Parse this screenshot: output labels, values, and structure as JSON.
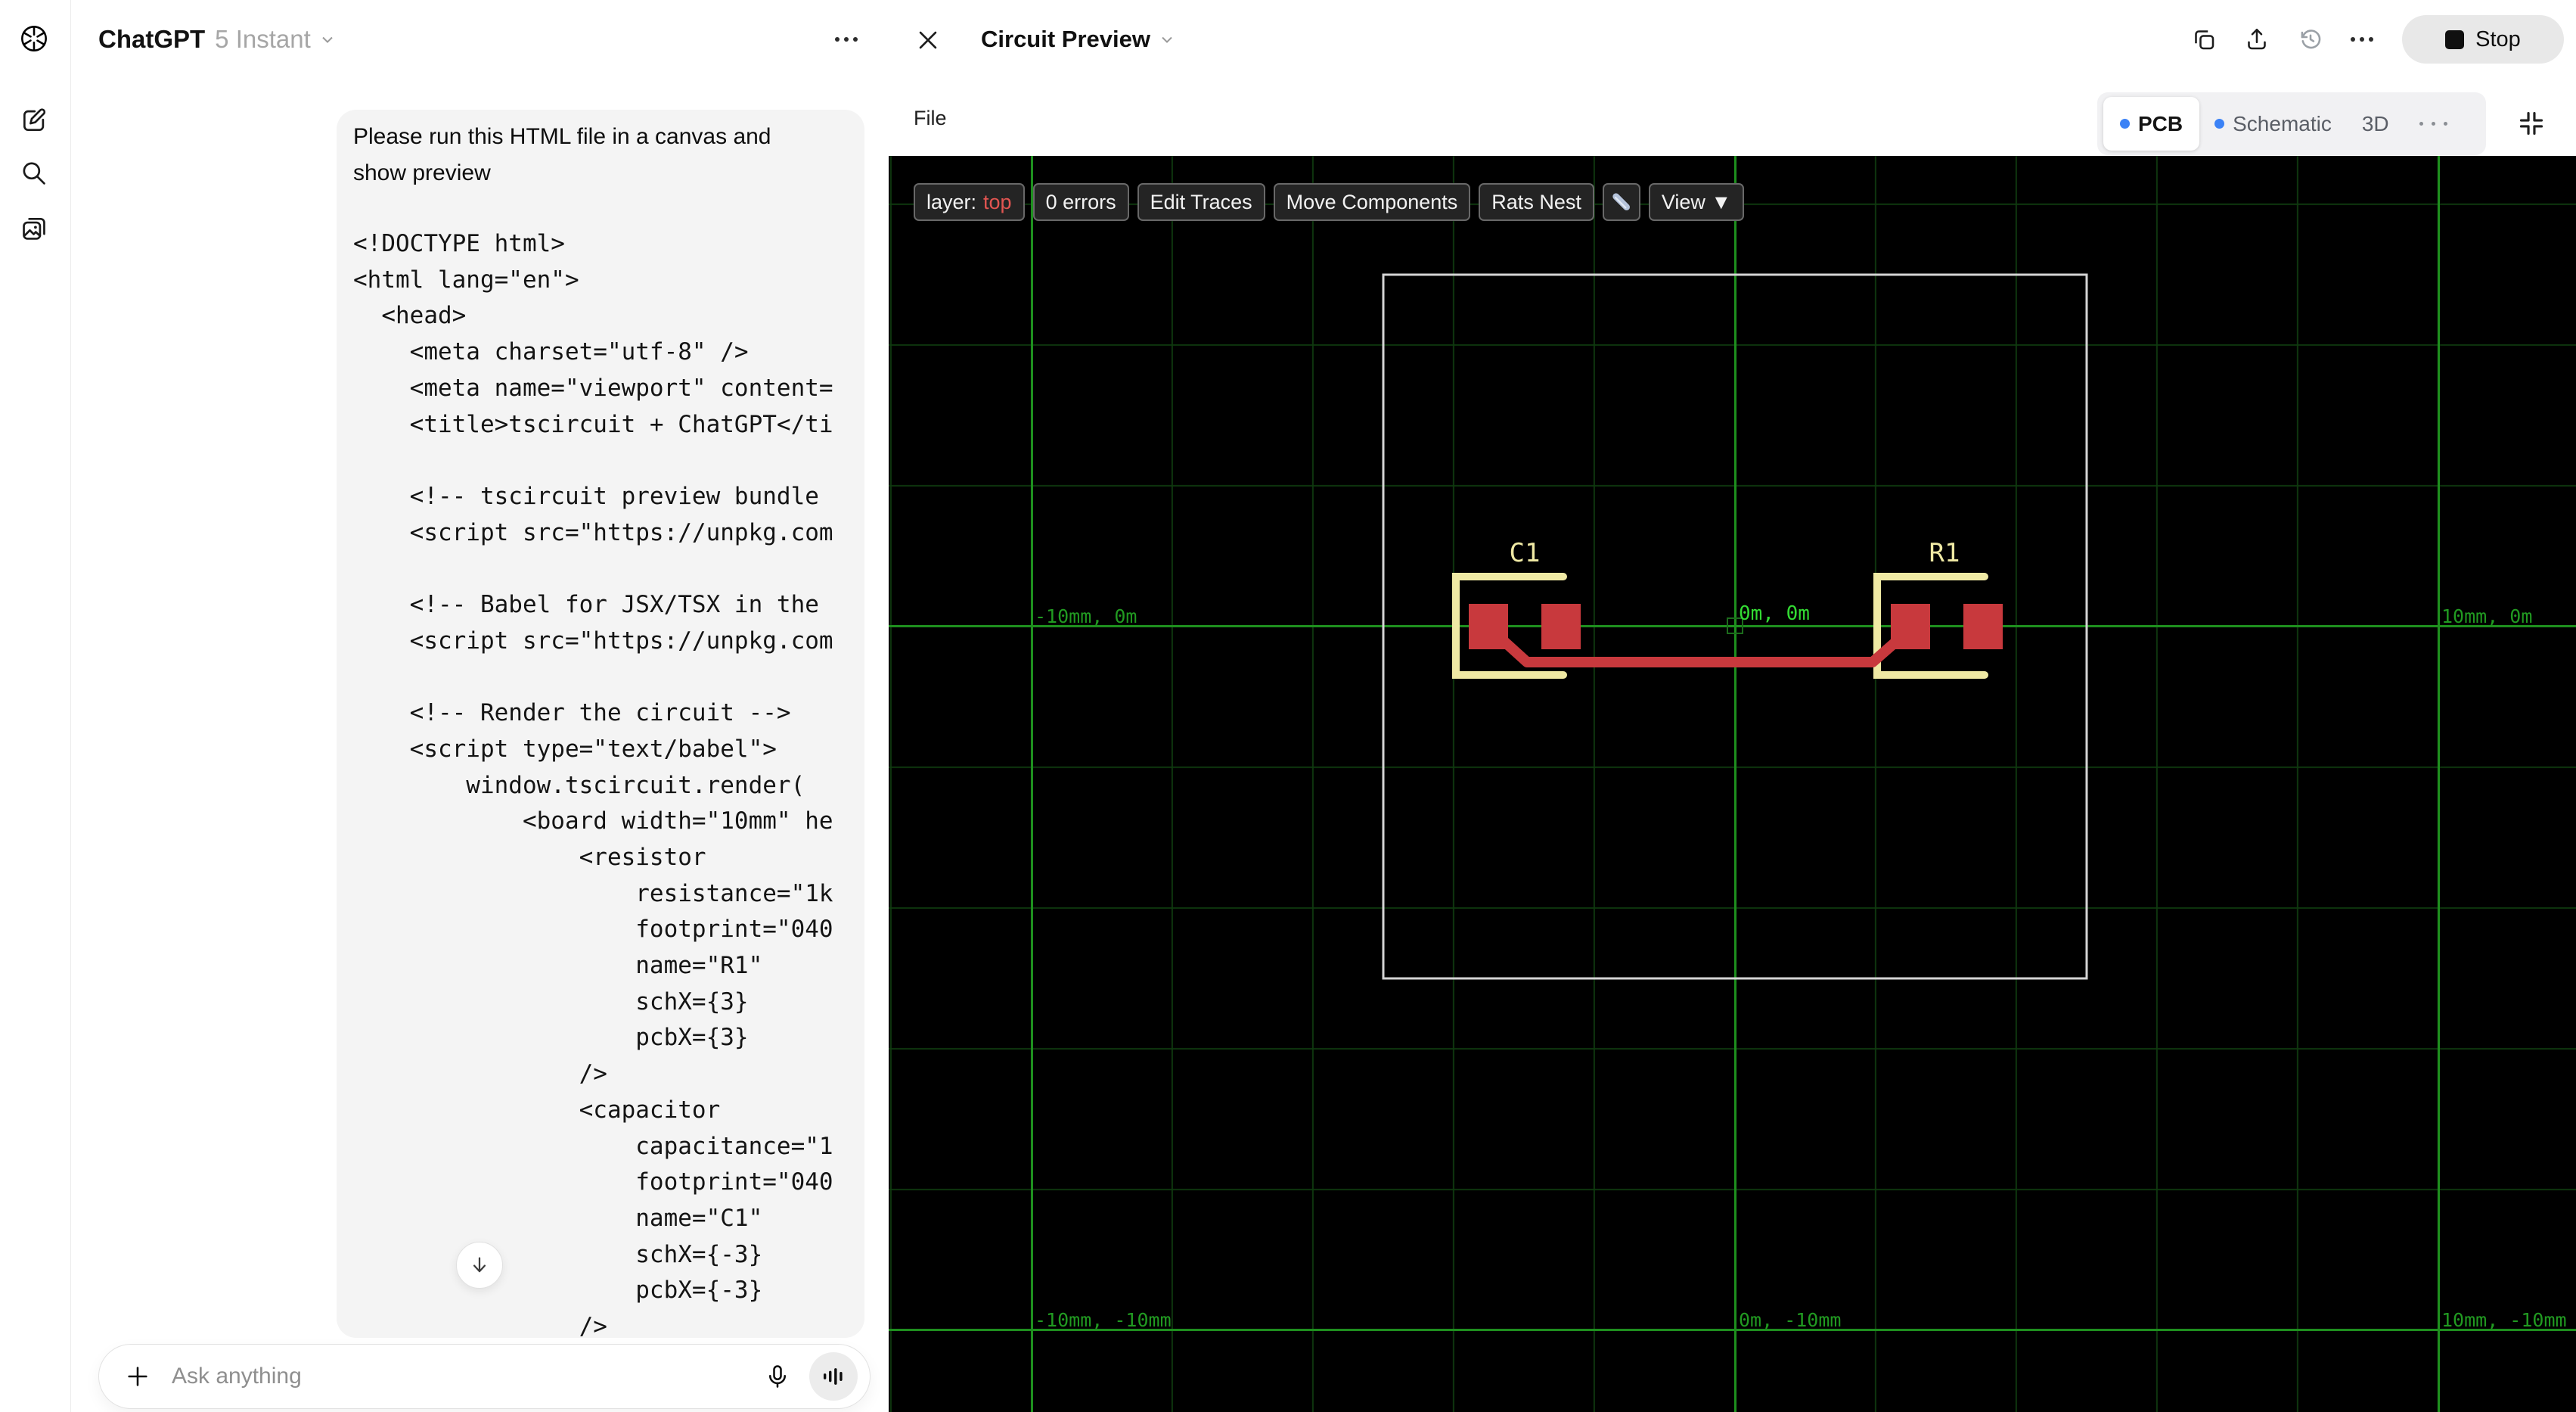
{
  "chat": {
    "header": {
      "app_name": "ChatGPT",
      "model": "5 Instant"
    },
    "message": {
      "text": "Please run this HTML file in a canvas and show preview",
      "code_lines": [
        "<!DOCTYPE html>",
        "<html lang=\"en\">",
        "  <head>",
        "    <meta charset=\"utf-8\" />",
        "    <meta name=\"viewport\" content=",
        "    <title>tscircuit + ChatGPT</ti",
        "",
        "    <!-- tscircuit preview bundle",
        "    <script src=\"https://unpkg.com",
        "",
        "    <!-- Babel for JSX/TSX in the",
        "    <script src=\"https://unpkg.com",
        "",
        "    <!-- Render the circuit -->",
        "    <script type=\"text/babel\">",
        "        window.tscircuit.render(",
        "            <board width=\"10mm\" he",
        "                <resistor",
        "                    resistance=\"1k",
        "                    footprint=\"040",
        "                    name=\"R1\"",
        "                    schX={3}",
        "                    pcbX={3}",
        "                />",
        "                <capacitor",
        "                    capacitance=\"1",
        "                    footprint=\"040",
        "                    name=\"C1\"",
        "                    schX={-3}",
        "                    pcbX={-3}",
        "                />"
      ]
    },
    "composer": {
      "placeholder": "Ask anything"
    }
  },
  "canvas_panel": {
    "title": "Circuit Preview",
    "file_menu": "File",
    "stop_button": {
      "label": "Stop"
    },
    "tabs": {
      "pcb": "PCB",
      "schematic": "Schematic",
      "threed": "3D"
    },
    "pcb_toolbar": {
      "layer_label": "layer:",
      "layer_value": "top",
      "errors": "0 errors",
      "edit_traces": "Edit Traces",
      "move_components": "Move Components",
      "rats_nest": "Rats Nest",
      "view": "View ▼"
    },
    "pcb_view": {
      "board": {
        "width_mm": 10,
        "height_mm": 10
      },
      "components": [
        {
          "ref": "C1",
          "pcb_x_mm": -3,
          "pcb_y_mm": 0
        },
        {
          "ref": "R1",
          "pcb_x_mm": 3,
          "pcb_y_mm": 0
        }
      ],
      "coord_labels": {
        "left_mid": "-10mm, 0m",
        "origin": "0m, 0m",
        "right_mid": "10mm, 0m",
        "left_bottom": "-10mm, -10mm",
        "bottom_mid": "0m, -10mm",
        "right_bottom": "10mm, -10mm"
      },
      "colors": {
        "pad_red": "#c8393d",
        "silkscreen": "#efe9a4",
        "board_outline": "#d4d4d4",
        "grid_major": "#1e8f1e",
        "grid_minor": "#0f3a0f",
        "label_green": "#219a21",
        "origin_label_green": "#33db33"
      }
    }
  },
  "icons": {
    "sidebar": [
      "openai-logo",
      "new-chat",
      "search",
      "library"
    ],
    "composer": [
      "plus",
      "microphone",
      "voice-waveform"
    ],
    "canvas_header": [
      "close",
      "chevron-down",
      "copy",
      "share",
      "history",
      "more",
      "collapse"
    ],
    "pcb_toolbar": [
      "pencil"
    ]
  }
}
